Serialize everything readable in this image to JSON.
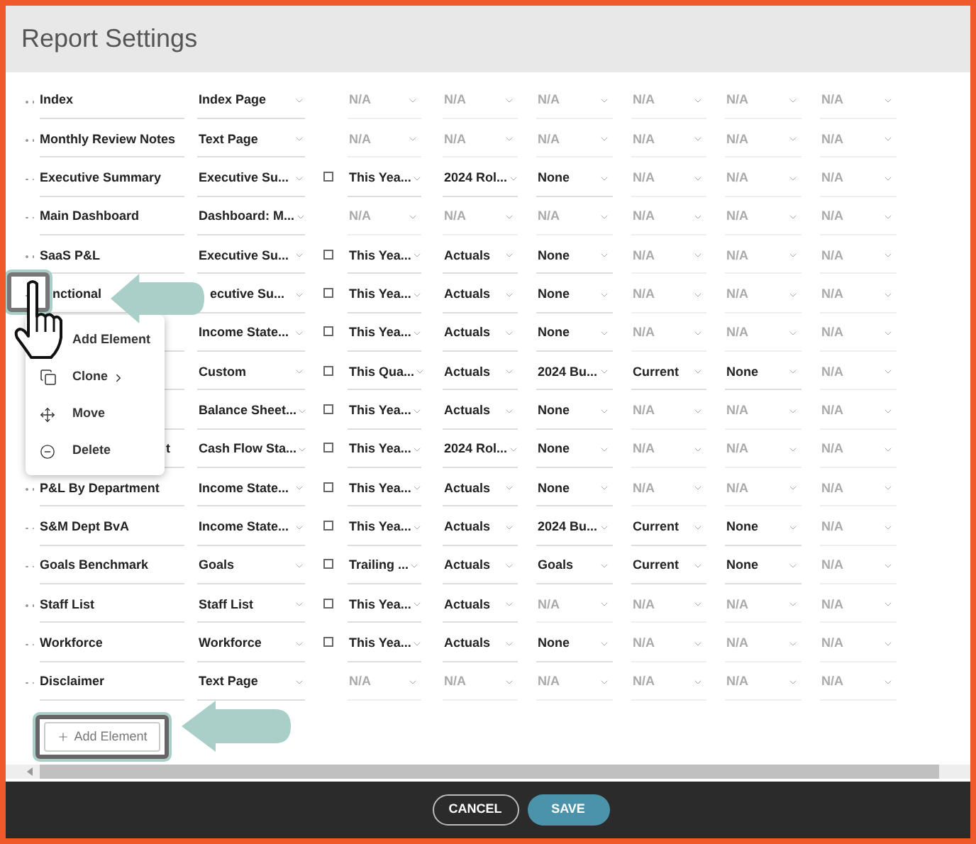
{
  "window": {
    "title": "Report Settings"
  },
  "rows": [
    {
      "name": "Index",
      "type": "Index Page",
      "values": [
        {
          "text": "N/A",
          "disabled": true
        },
        {
          "text": "N/A",
          "disabled": true
        },
        {
          "text": "N/A",
          "disabled": true
        },
        {
          "text": "N/A",
          "disabled": true
        },
        {
          "text": "N/A",
          "disabled": true
        },
        {
          "text": "N/A",
          "disabled": true
        }
      ]
    },
    {
      "name": "Monthly Review Notes",
      "type": "Text Page",
      "values": [
        {
          "text": "N/A",
          "disabled": true
        },
        {
          "text": "N/A",
          "disabled": true
        },
        {
          "text": "N/A",
          "disabled": true
        },
        {
          "text": "N/A",
          "disabled": true
        },
        {
          "text": "N/A",
          "disabled": true
        },
        {
          "text": "N/A",
          "disabled": true
        }
      ]
    },
    {
      "name": "Executive Summary",
      "type": "Executive Su...",
      "checkbox": {
        "checked": false
      },
      "values": [
        {
          "text": "This Yea...",
          "disabled": false
        },
        {
          "text": "2024 Rol...",
          "disabled": false
        },
        {
          "text": "None",
          "disabled": false
        },
        {
          "text": "N/A",
          "disabled": true
        },
        {
          "text": "N/A",
          "disabled": true
        },
        {
          "text": "N/A",
          "disabled": true
        }
      ]
    },
    {
      "name": "Main Dashboard",
      "type": "Dashboard: M...",
      "values": [
        {
          "text": "N/A",
          "disabled": true
        },
        {
          "text": "N/A",
          "disabled": true
        },
        {
          "text": "N/A",
          "disabled": true
        },
        {
          "text": "N/A",
          "disabled": true
        },
        {
          "text": "N/A",
          "disabled": true
        },
        {
          "text": "N/A",
          "disabled": true
        }
      ]
    },
    {
      "name": "SaaS P&L",
      "type": "Executive Su...",
      "checkbox": {
        "checked": false
      },
      "values": [
        {
          "text": "This Yea...",
          "disabled": false
        },
        {
          "text": "Actuals",
          "disabled": false
        },
        {
          "text": "None",
          "disabled": false
        },
        {
          "text": "N/A",
          "disabled": true
        },
        {
          "text": "N/A",
          "disabled": true
        },
        {
          "text": "N/A",
          "disabled": true
        }
      ]
    },
    {
      "name": "nctional",
      "name_covered_start": true,
      "type": "ecutive Su...",
      "type_covered_start": true,
      "checkbox": {
        "checked": false
      },
      "values": [
        {
          "text": "This Yea...",
          "disabled": false
        },
        {
          "text": "Actuals",
          "disabled": false
        },
        {
          "text": "None",
          "disabled": false
        },
        {
          "text": "N/A",
          "disabled": true
        },
        {
          "text": "N/A",
          "disabled": true
        },
        {
          "text": "N/A",
          "disabled": true
        }
      ]
    },
    {
      "type": "Income State...",
      "checkbox": {
        "checked": false
      },
      "values": [
        {
          "text": "This Yea...",
          "disabled": false
        },
        {
          "text": "Actuals",
          "disabled": false
        },
        {
          "text": "None",
          "disabled": false
        },
        {
          "text": "N/A",
          "disabled": true
        },
        {
          "text": "N/A",
          "disabled": true
        },
        {
          "text": "N/A",
          "disabled": true
        }
      ]
    },
    {
      "type": "Custom",
      "checkbox": {
        "checked": false
      },
      "values": [
        {
          "text": "This Qua...",
          "disabled": false
        },
        {
          "text": "Actuals",
          "disabled": false
        },
        {
          "text": "2024 Bu...",
          "disabled": false
        },
        {
          "text": "Current",
          "disabled": false
        },
        {
          "text": "None",
          "disabled": false
        },
        {
          "text": "N/A",
          "disabled": true
        }
      ]
    },
    {
      "type": "Balance Sheet...",
      "checkbox": {
        "checked": false
      },
      "values": [
        {
          "text": "This Yea...",
          "disabled": false
        },
        {
          "text": "Actuals",
          "disabled": false
        },
        {
          "text": "None",
          "disabled": false
        },
        {
          "text": "N/A",
          "disabled": true
        },
        {
          "text": "N/A",
          "disabled": true
        },
        {
          "text": "N/A",
          "disabled": true
        }
      ]
    },
    {
      "name": "t",
      "name_tail_only": true,
      "type": "Cash Flow Sta...",
      "checkbox": {
        "checked": false
      },
      "values": [
        {
          "text": "This Yea...",
          "disabled": false
        },
        {
          "text": "2024 Rol...",
          "disabled": false
        },
        {
          "text": "None",
          "disabled": false
        },
        {
          "text": "N/A",
          "disabled": true
        },
        {
          "text": "N/A",
          "disabled": true
        },
        {
          "text": "N/A",
          "disabled": true
        }
      ]
    },
    {
      "name": "P&L By Department",
      "type": "Income State...",
      "checkbox": {
        "checked": false
      },
      "values": [
        {
          "text": "This Yea...",
          "disabled": false
        },
        {
          "text": "Actuals",
          "disabled": false
        },
        {
          "text": "None",
          "disabled": false
        },
        {
          "text": "N/A",
          "disabled": true
        },
        {
          "text": "N/A",
          "disabled": true
        },
        {
          "text": "N/A",
          "disabled": true
        }
      ]
    },
    {
      "name": "S&M Dept BvA",
      "type": "Income State...",
      "checkbox": {
        "checked": false
      },
      "values": [
        {
          "text": "This Yea...",
          "disabled": false
        },
        {
          "text": "Actuals",
          "disabled": false
        },
        {
          "text": "2024 Bu...",
          "disabled": false
        },
        {
          "text": "Current",
          "disabled": false
        },
        {
          "text": "None",
          "disabled": false
        },
        {
          "text": "N/A",
          "disabled": true
        }
      ]
    },
    {
      "name": "Goals Benchmark",
      "type": "Goals",
      "checkbox": {
        "checked": false
      },
      "values": [
        {
          "text": "Trailing ...",
          "disabled": false
        },
        {
          "text": "Actuals",
          "disabled": false
        },
        {
          "text": "Goals",
          "disabled": false
        },
        {
          "text": "Current",
          "disabled": false
        },
        {
          "text": "None",
          "disabled": false
        },
        {
          "text": "N/A",
          "disabled": true
        }
      ]
    },
    {
      "name": "Staff List",
      "type": "Staff List",
      "checkbox": {
        "checked": false
      },
      "values": [
        {
          "text": "This Yea...",
          "disabled": false
        },
        {
          "text": "Actuals",
          "disabled": false
        },
        {
          "text": "N/A",
          "disabled": true
        },
        {
          "text": "N/A",
          "disabled": true
        },
        {
          "text": "N/A",
          "disabled": true
        },
        {
          "text": "N/A",
          "disabled": true
        }
      ]
    },
    {
      "name": "Workforce",
      "type": "Workforce",
      "checkbox": {
        "checked": false
      },
      "values": [
        {
          "text": "This Yea...",
          "disabled": false
        },
        {
          "text": "Actuals",
          "disabled": false
        },
        {
          "text": "None",
          "disabled": false
        },
        {
          "text": "N/A",
          "disabled": true
        },
        {
          "text": "N/A",
          "disabled": true
        },
        {
          "text": "N/A",
          "disabled": true
        }
      ]
    },
    {
      "name": "Disclaimer",
      "type": "Text Page",
      "values": [
        {
          "text": "N/A",
          "disabled": true
        },
        {
          "text": "N/A",
          "disabled": true
        },
        {
          "text": "N/A",
          "disabled": true
        },
        {
          "text": "N/A",
          "disabled": true
        },
        {
          "text": "N/A",
          "disabled": true
        },
        {
          "text": "N/A",
          "disabled": true
        }
      ]
    }
  ],
  "add_button": {
    "label": "Add Element"
  },
  "context_menu": {
    "items": [
      {
        "label": "Add Element",
        "submenu": false
      },
      {
        "label": "Clone",
        "submenu": true
      },
      {
        "label": "Move",
        "submenu": false
      },
      {
        "label": "Delete",
        "submenu": false
      }
    ]
  },
  "footer_buttons": [
    {
      "label": "CANCEL",
      "kind": "secondary"
    },
    {
      "label": "SAVE",
      "kind": "primary"
    }
  ]
}
